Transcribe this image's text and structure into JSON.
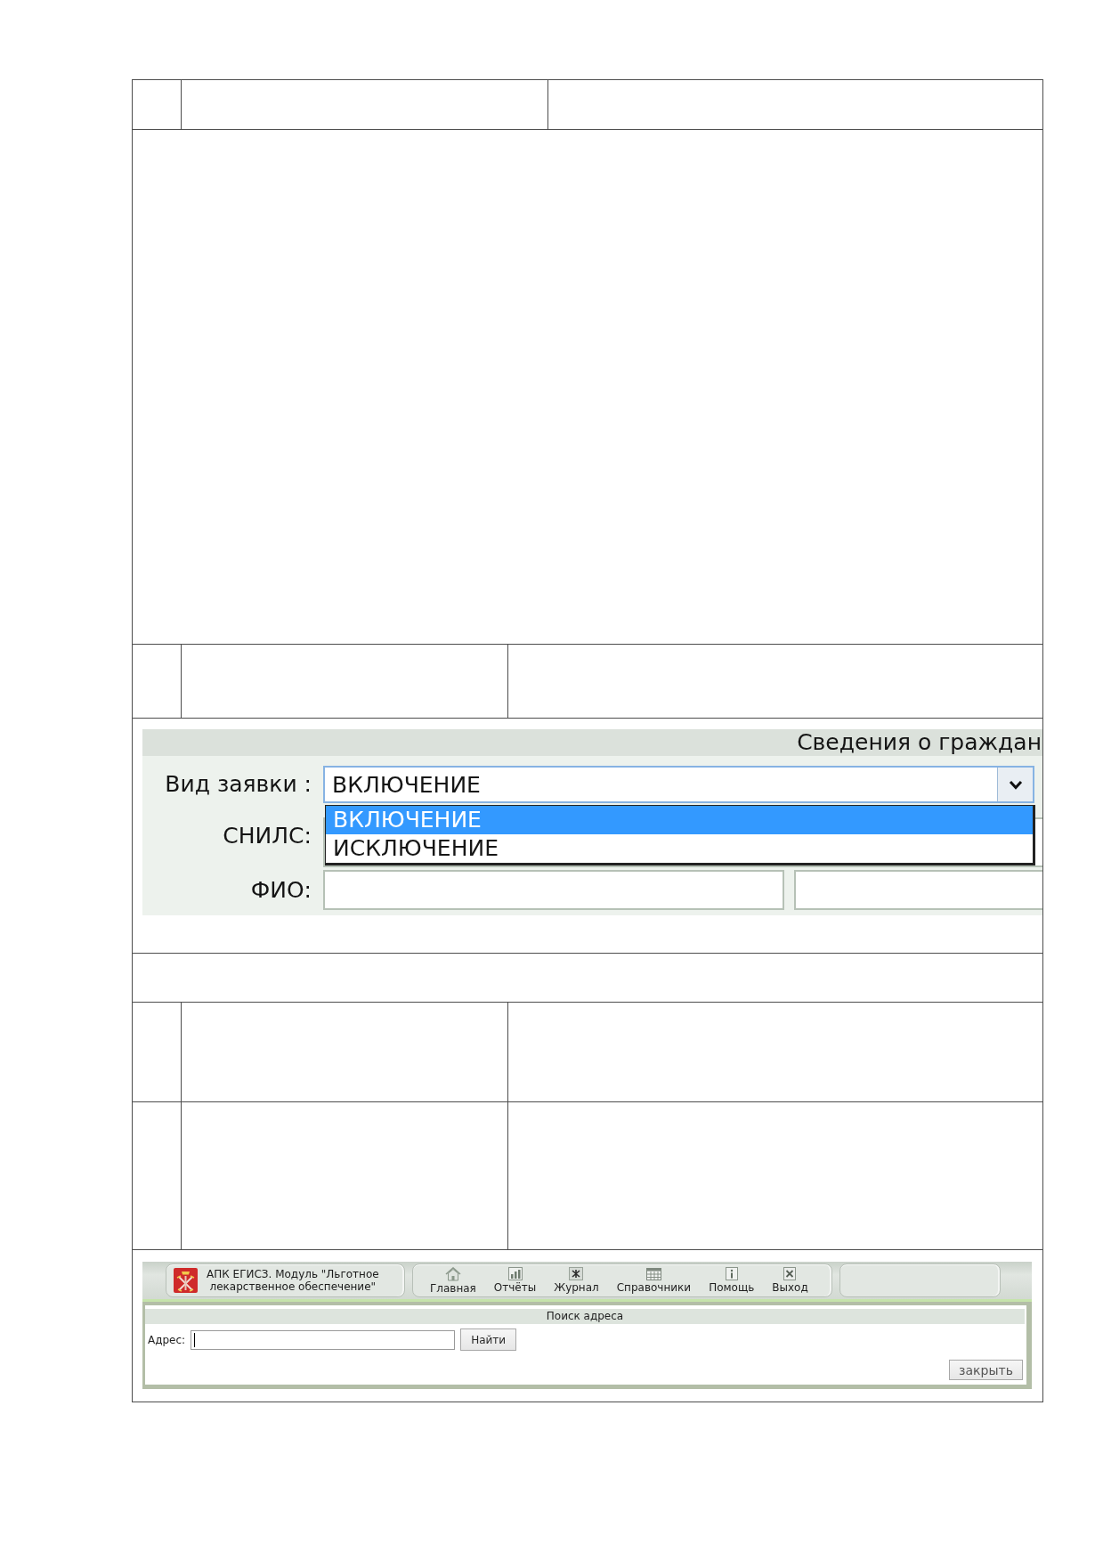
{
  "table": {
    "rows": [
      {
        "kind": "cells"
      },
      {
        "kind": "cell"
      },
      {
        "kind": "cells"
      },
      {
        "kind": "request_form",
        "title": "Сведения о граждан",
        "request_type": {
          "label": "Вид заявки :",
          "value": "ВКЛЮЧЕНИЕ",
          "expanded": true,
          "options": [
            {
              "label": "ВКЛЮЧЕНИЕ",
              "selected": true
            },
            {
              "label": "ИСКЛЮЧЕНИЕ",
              "selected": false
            }
          ]
        },
        "snils": {
          "label": "СНИЛС:"
        },
        "fio": {
          "label": "ФИО:"
        }
      },
      {
        "kind": "cell"
      },
      {
        "kind": "cells"
      },
      {
        "kind": "cells"
      },
      {
        "kind": "address_search_app",
        "app_title": "АПК ЕГИСЗ. Модуль \"Льготное\nлекарственное обеспечение\"",
        "nav": [
          {
            "label": "Главная"
          },
          {
            "label": "Отчёты"
          },
          {
            "label": "Журнал"
          },
          {
            "label": "Справочники"
          },
          {
            "label": "Помощь"
          },
          {
            "label": "Выход"
          }
        ],
        "dialog": {
          "title": "Поиск адреса",
          "address": {
            "label": "Адрес:",
            "focused": true
          },
          "find_button": "Найти",
          "close_button": "закрыть"
        }
      }
    ]
  }
}
